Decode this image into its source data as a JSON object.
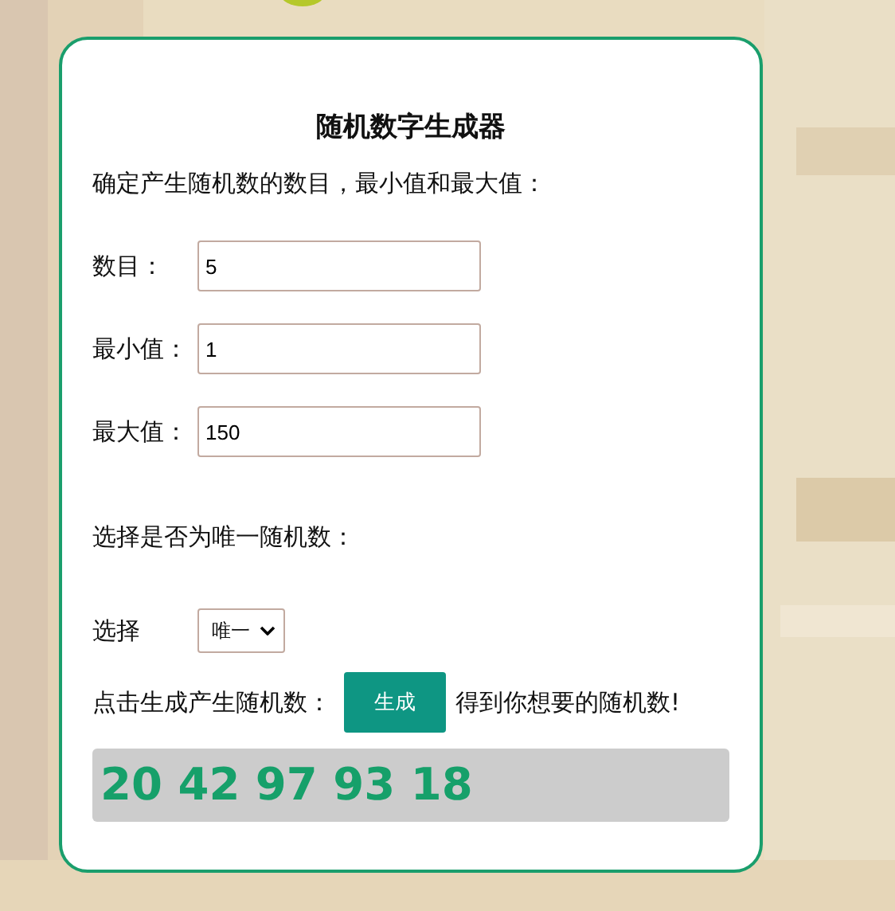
{
  "title": "随机数字生成器",
  "intro": "确定产生随机数的数目，最小值和最大值：",
  "fields": [
    {
      "label": "数目：",
      "value": "5"
    },
    {
      "label": "最小值：",
      "value": "1"
    },
    {
      "label": "最大值：",
      "value": "150"
    }
  ],
  "unique_prompt": "选择是否为唯一随机数：",
  "select": {
    "label": "选择",
    "value": "唯一"
  },
  "generate": {
    "prompt": "点击生成产生随机数：",
    "button": "生成",
    "suffix": "得到你想要的随机数!"
  },
  "result": "20 42 97 93 18"
}
